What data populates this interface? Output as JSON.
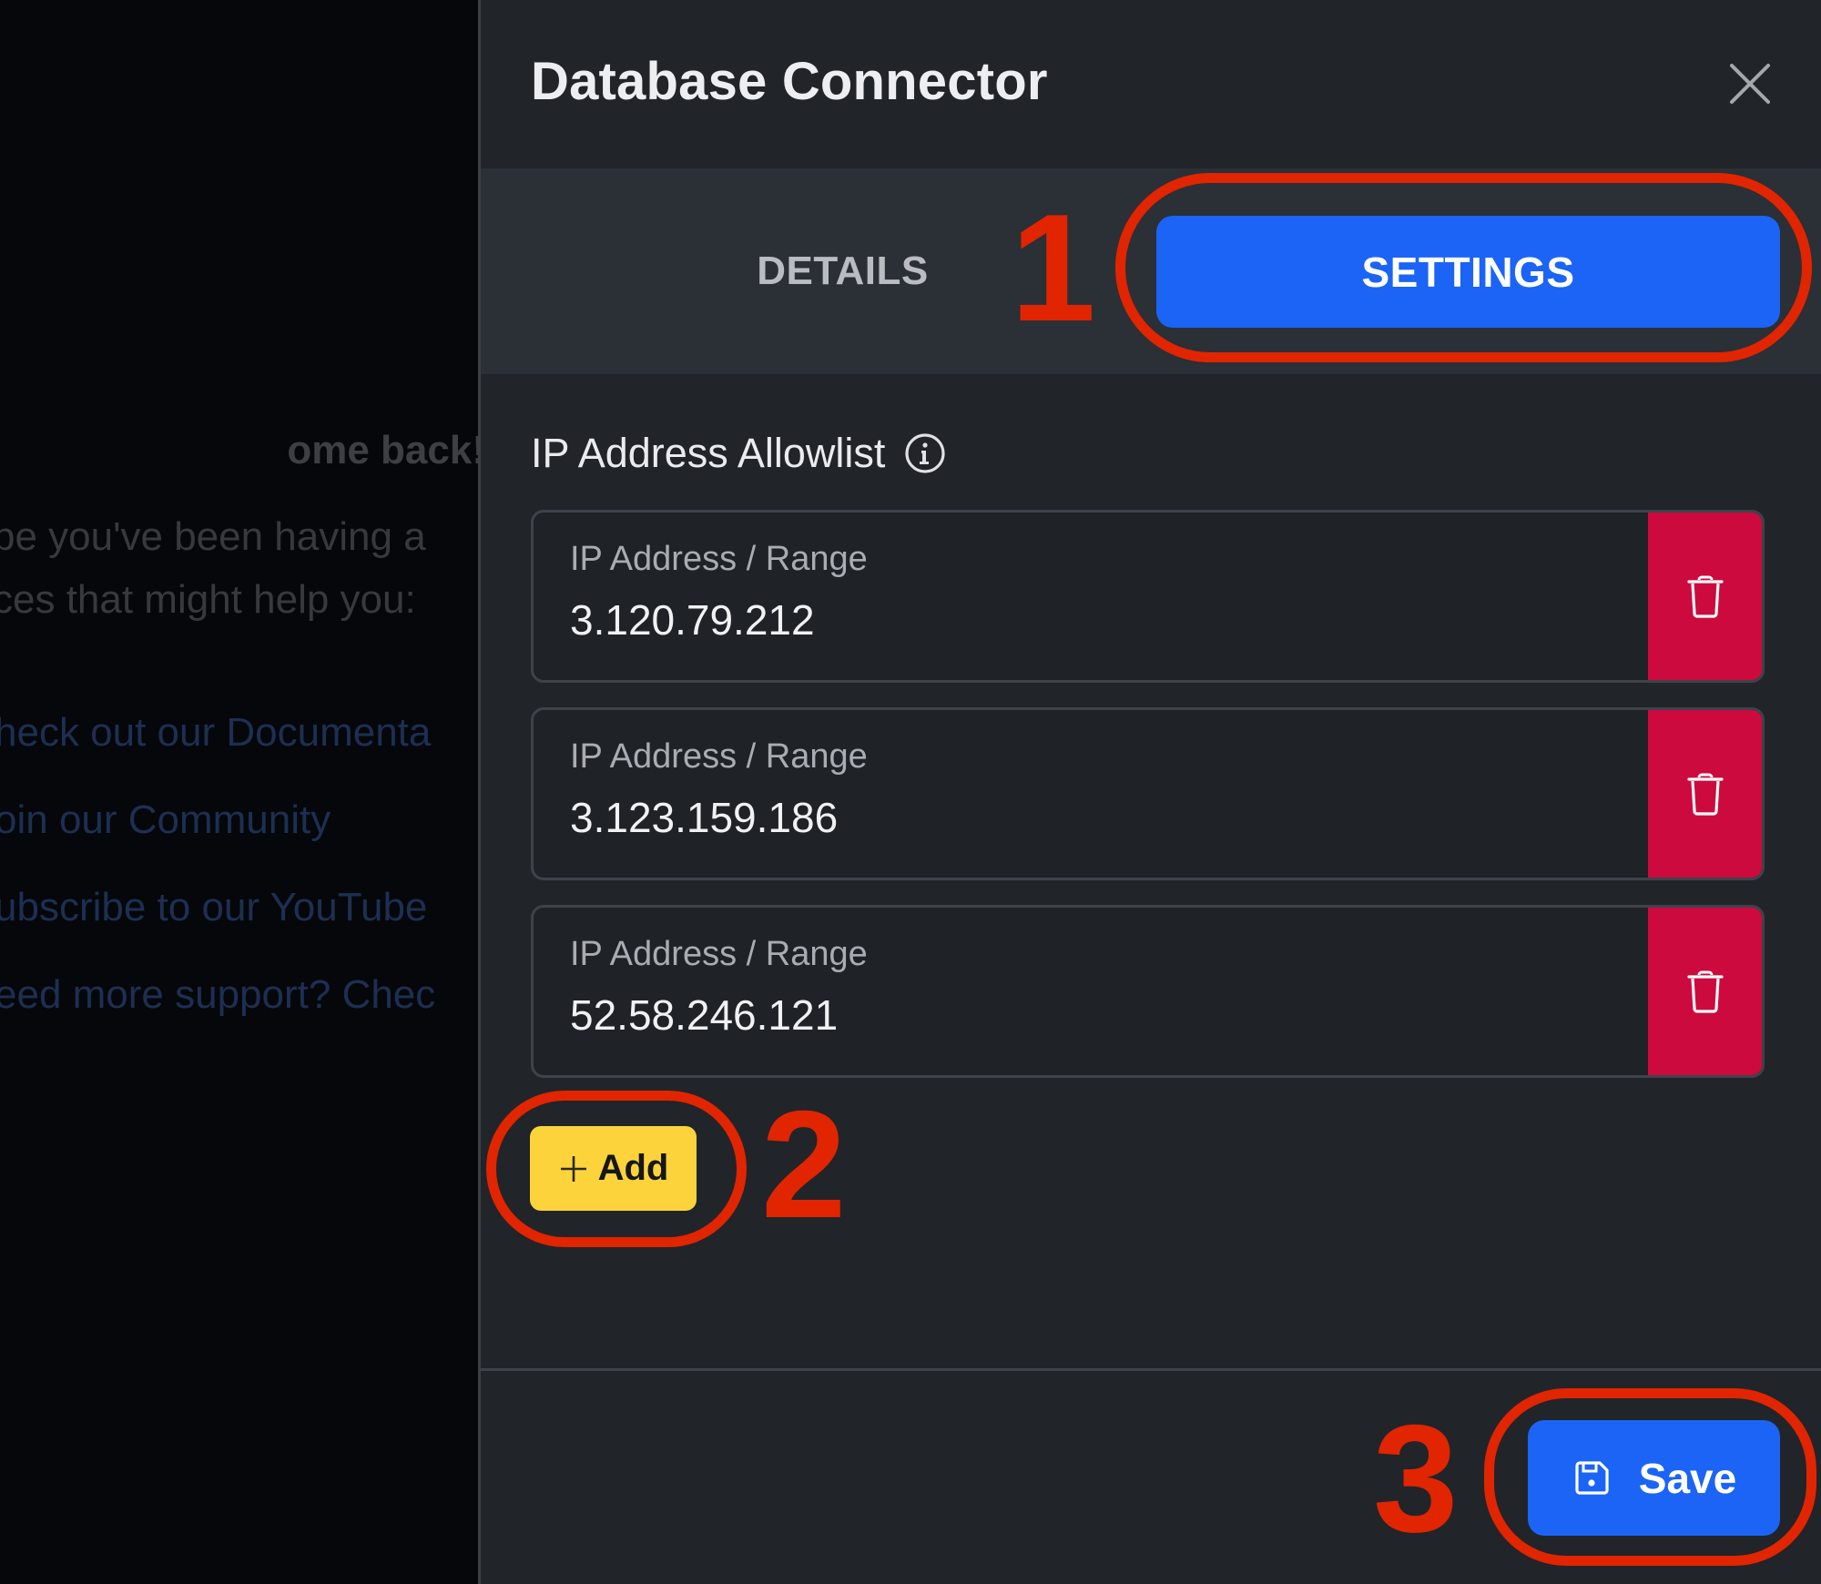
{
  "backdrop": {
    "heading": "ome back!",
    "body_lines": [
      "pe you've been having a",
      "ces that might help you:"
    ],
    "links": [
      "heck out our Documenta",
      "oin our Community",
      "ubscribe to our YouTube",
      "eed more support? Chec"
    ]
  },
  "panel": {
    "title": "Database Connector",
    "close_icon": "close-icon",
    "tabs": [
      {
        "label": "DETAILS",
        "active": false
      },
      {
        "label": "SETTINGS",
        "active": true
      }
    ],
    "section": {
      "label": "IP Address Allowlist",
      "info_icon": "info-circle-icon"
    },
    "allowlist": [
      {
        "field_label": "IP Address / Range",
        "value": "3.120.79.212",
        "delete_icon": "trash-icon"
      },
      {
        "field_label": "IP Address / Range",
        "value": "3.123.159.186",
        "delete_icon": "trash-icon"
      },
      {
        "field_label": "IP Address / Range",
        "value": "52.58.246.121",
        "delete_icon": "trash-icon"
      }
    ],
    "add_button": {
      "label": "Add",
      "icon": "plus-icon"
    },
    "save_button": {
      "label": "Save",
      "icon": "floppy-disk-icon"
    }
  },
  "annotations": [
    {
      "number": "1",
      "target": "SETTINGS tab"
    },
    {
      "number": "2",
      "target": "Add button"
    },
    {
      "number": "3",
      "target": "Save button"
    }
  ],
  "colors": {
    "primary": "#1b64f5",
    "danger": "#cc0a3e",
    "warning": "#fcd33b",
    "annotation": "#e12500",
    "panel_bg": "#212429",
    "tabbar_bg": "#2b2f36"
  }
}
